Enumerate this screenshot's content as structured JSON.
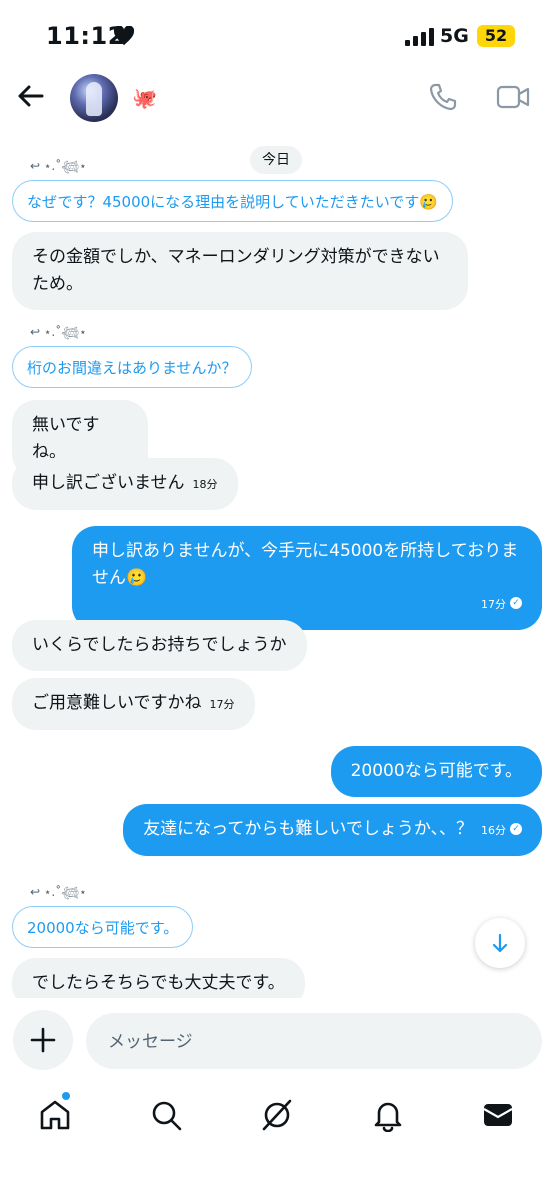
{
  "status": {
    "time": "11:12",
    "network": "5G",
    "battery": "52"
  },
  "header": {
    "avatar_emoji": "🐙"
  },
  "chat": {
    "date": "今日",
    "reply_name": "↩ ⋆.˚𓆉⋆",
    "messages": [
      {
        "type": "quote",
        "text": "なぜです？45000になる理由を説明していただきたいです🥲"
      },
      {
        "type": "in",
        "text": "その金額でしか、マネーロンダリング対策ができないため。"
      },
      {
        "type": "quote",
        "text": "桁のお間違えはありませんか？"
      },
      {
        "type": "in",
        "text": "無いですね。"
      },
      {
        "type": "in",
        "text": "申し訳ございません",
        "time": "18分"
      },
      {
        "type": "out",
        "text": "申し訳ありませんが、今手元に45000を所持しておりません🥲",
        "time": "17分"
      },
      {
        "type": "in",
        "text": "いくらでしたらお持ちでしょうか"
      },
      {
        "type": "in",
        "text": "ご用意難しいですかね",
        "time": "17分"
      },
      {
        "type": "out",
        "text": "20000なら可能です。"
      },
      {
        "type": "out",
        "text": "友達になってからも難しいでしょうか、、？",
        "time": "16分"
      },
      {
        "type": "quote",
        "text": "20000なら可能です。"
      },
      {
        "type": "in",
        "text": "でしたらそちらでも大丈夫です。"
      }
    ]
  },
  "compose": {
    "placeholder": "メッセージ"
  },
  "colors": {
    "accent": "#1d9bf0",
    "incoming_bg": "#eff3f4",
    "battery": "#ffd60a"
  }
}
